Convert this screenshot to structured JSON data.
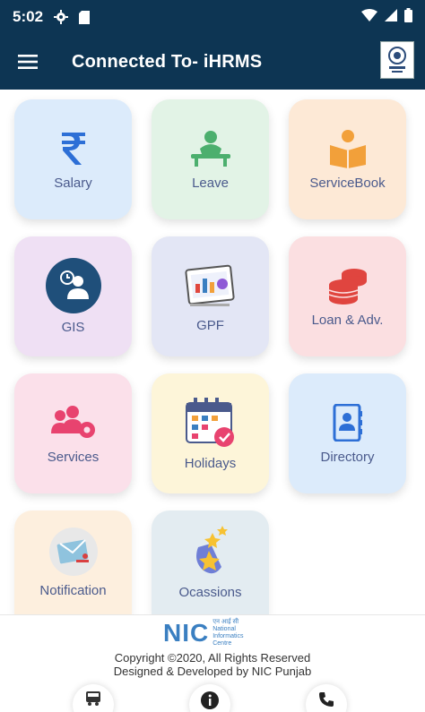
{
  "statusbar": {
    "time": "5:02"
  },
  "appbar": {
    "title": "Connected To- iHRMS"
  },
  "tiles": [
    {
      "label": "Salary",
      "bg": "#dcebfb"
    },
    {
      "label": "Leave",
      "bg": "#e2f3e6"
    },
    {
      "label": "ServiceBook",
      "bg": "#fde9d6"
    },
    {
      "label": "GIS",
      "bg": "#efe0f4"
    },
    {
      "label": "GPF",
      "bg": "#e3e6f5"
    },
    {
      "label": "Loan & Adv.",
      "bg": "#fbdfe1"
    },
    {
      "label": "Services",
      "bg": "#fbe0ea"
    },
    {
      "label": "Holidays",
      "bg": "#fdf5d9"
    },
    {
      "label": "Directory",
      "bg": "#dcebfb"
    },
    {
      "label": "Notification",
      "bg": "#fdefde"
    },
    {
      "label": "Ocassions",
      "bg": "#e3ecf1"
    }
  ],
  "footer": {
    "logo_text": "NIC",
    "logo_sub_hindi": "एन आई सी",
    "logo_sub_1": "National",
    "logo_sub_2": "Informatics",
    "logo_sub_3": "Centre",
    "copyright": "Copyright ©2020, All Rights Reserved",
    "designed_by": "Designed & Developed  by NIC Punjab"
  },
  "icons": {
    "salary": "rupee-icon",
    "leave": "person-relaxing-icon",
    "servicebook": "reader-book-icon",
    "gis": "person-clock-icon",
    "gpf": "finance-dashboard-icon",
    "loan": "coin-stack-icon",
    "services": "people-gear-icon",
    "holidays": "calendar-check-icon",
    "directory": "contact-book-icon",
    "notification": "notification-envelope-icon",
    "ocassions": "stars-icon"
  }
}
